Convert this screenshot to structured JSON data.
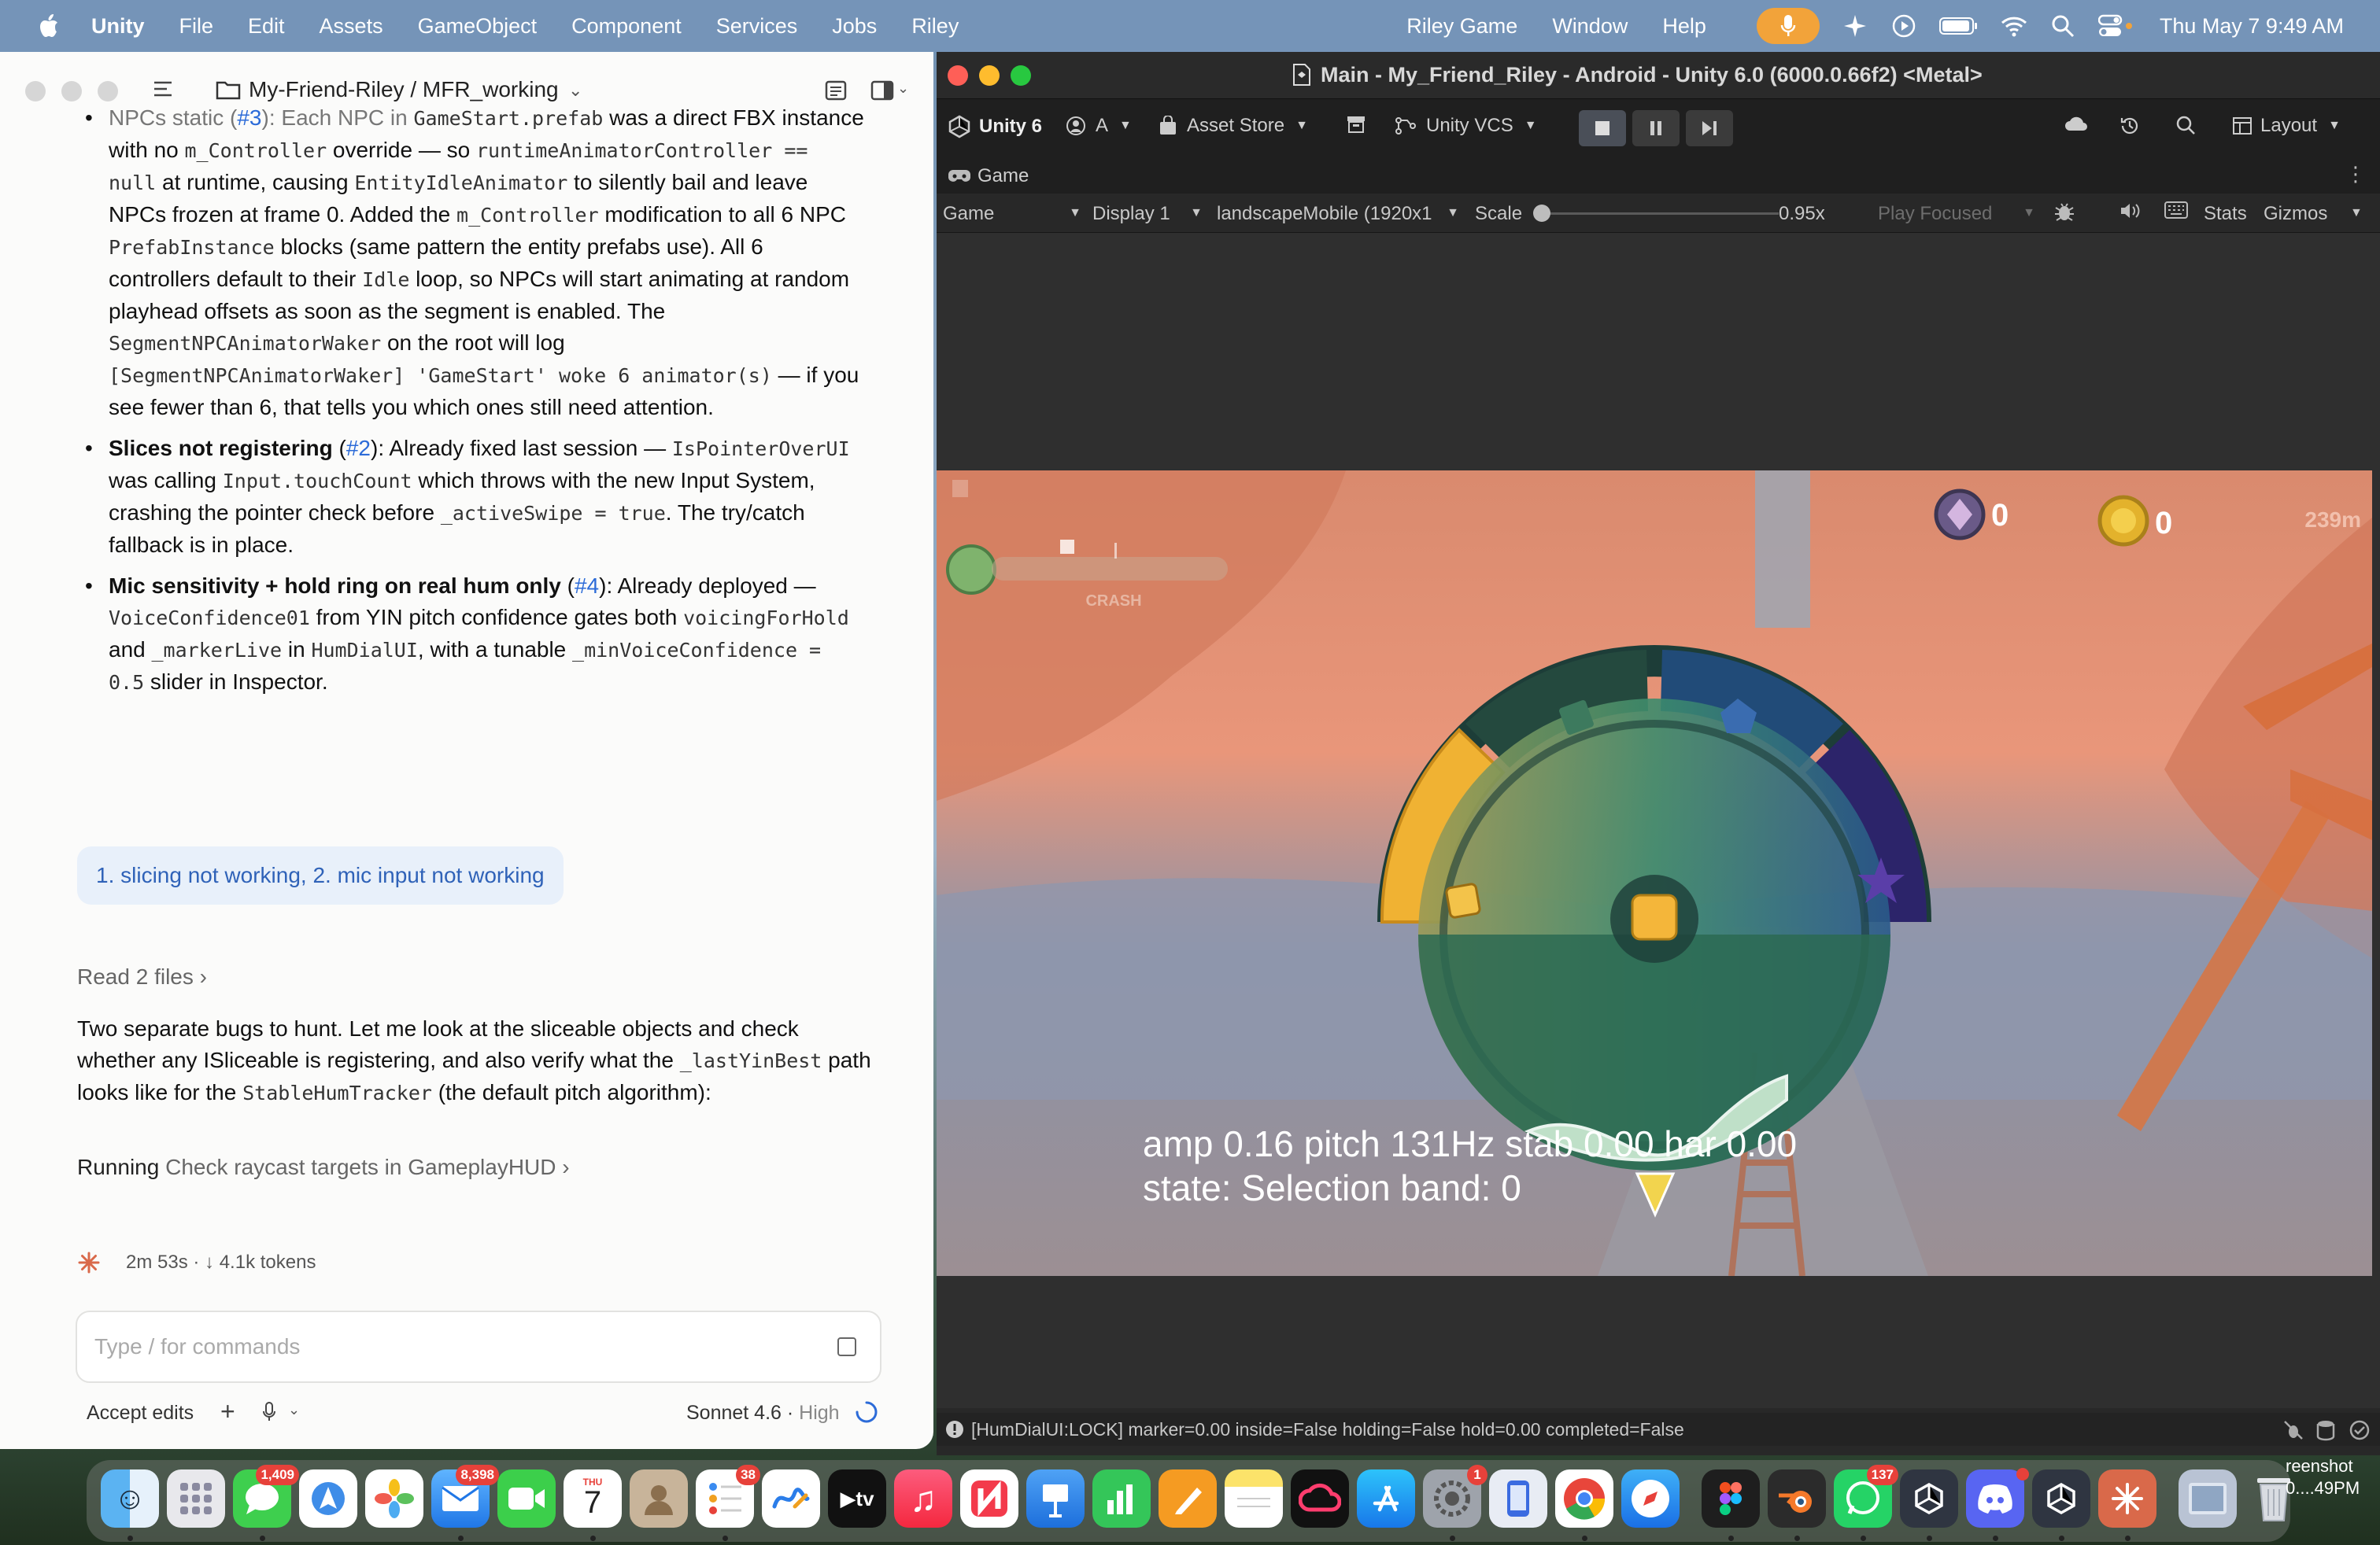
{
  "menubar": {
    "app_name": "Unity",
    "items": [
      "File",
      "Edit",
      "Assets",
      "GameObject",
      "Component",
      "Services",
      "Jobs",
      "Riley"
    ],
    "right_items": [
      "Riley Game",
      "Window",
      "Help"
    ],
    "datetime": "Thu May 7  9:49 AM",
    "icons": [
      "microphone-icon",
      "sparkle-icon",
      "play-circle-icon",
      "battery-icon",
      "wifi-icon",
      "search-icon",
      "control-center-icon"
    ]
  },
  "chat": {
    "breadcrumb": "My-Friend-Riley / MFR_working",
    "bullets": {
      "npc": {
        "title": "NPCs static",
        "ref": "#3",
        "t1": ": Each NPC in ",
        "c1": "GameStart.prefab",
        "t2": " was a direct FBX instance with no ",
        "c2": "m_Controller",
        "t3": " override — so ",
        "c3": "runtimeAnimatorController == null",
        "t4": " at runtime, causing ",
        "c4": "EntityIdleAnimator",
        "t5": " to silently bail and leave NPCs frozen at frame 0. Added the ",
        "c5": "m_Controller",
        "t6": " modification to all 6 NPC ",
        "c6": "PrefabInstance",
        "t7": " blocks (same pattern the entity prefabs use). All 6 controllers default to their ",
        "c7": "Idle",
        "t8": " loop, so NPCs will start animating at random playhead offsets as soon as the segment is enabled. The ",
        "c8": "SegmentNPCAnimatorWaker",
        "t9": " on the root will log ",
        "c9": "[SegmentNPCAnimatorWaker] 'GameStart' woke 6 animator(s)",
        "t10": " — if you see fewer than 6, that tells you which ones still need attention."
      },
      "slices": {
        "title": "Slices not registering",
        "ref": "#2",
        "t1": ": Already fixed last session — ",
        "c1": "IsPointerOverUI",
        "t2": " was calling ",
        "c2": "Input.touchCount",
        "t3": " which throws with the new Input System, crashing the pointer check before ",
        "c3": "_activeSwipe = true",
        "t4": ". The try/catch fallback is in place."
      },
      "mic": {
        "title": "Mic sensitivity + hold ring on real hum only",
        "ref": "#4",
        "t1": ": Already deployed — ",
        "c1": "VoiceConfidence01",
        "t2": " from YIN pitch confidence gates both ",
        "c2": "voicingForHold",
        "t3": " and ",
        "c3": "_markerLive",
        "t4": " in ",
        "c4": "HumDialUI",
        "t5": ", with a tunable ",
        "c5": "_minVoiceConfidence = 0.5",
        "t6": " slider in Inspector."
      }
    },
    "user_message": "1. slicing not working, 2. mic input not working",
    "read_files": "Read 2 files",
    "assistant_para": {
      "t1": "Two separate bugs to hunt. Let me look at the sliceable objects and check whether any ISliceable is registering, and also verify what the ",
      "c1": "_lastYinBest",
      "t2": " path looks like for the ",
      "c2": "StableHumTracker",
      "t3": " (the default pitch algorithm):"
    },
    "running_label": "Running",
    "running_task": "Check raycast targets in GameplayHUD",
    "status": "2m 53s · ↓ 4.1k tokens",
    "input_placeholder": "Type / for commands",
    "accept_label": "Accept edits",
    "model": "Sonnet 4.6",
    "effort": "High"
  },
  "unity": {
    "window_title": "Main - My_Friend_Riley - Android - Unity 6.0 (6000.0.66f2) <Metal>",
    "toolbar": {
      "unity_label": "Unity 6",
      "account": "A",
      "asset_store": "Asset Store",
      "vcs": "Unity VCS",
      "layout": "Layout"
    },
    "tab": "Game",
    "gamebar": {
      "mode": "Game",
      "display": "Display 1",
      "resolution": "landscapeMobile (1920x1",
      "scale_label": "Scale",
      "scale_value": "0.95x",
      "play_focused": "Play Focused",
      "stats": "Stats",
      "gizmos": "Gizmos"
    },
    "scale_level": 0.0,
    "hud": {
      "gem_count": "0",
      "coin_count": "0",
      "distance": "239m",
      "crash_label": "CRASH",
      "line1": "amp 0.16  pitch 131Hz  stab 0.00  har 0.00",
      "line2": "state: Selection  band: 0"
    },
    "console": "[HumDialUI:LOCK] marker=0.00 inside=False holding=False hold=0.00 completed=False"
  },
  "dock": {
    "badges": {
      "messages": "1,409",
      "mail": "8,398",
      "calendar_day": "7",
      "reminders": "38",
      "settings": "1",
      "whatsapp": "137"
    },
    "screenshot_label_1": "reenshot",
    "screenshot_label_2": "0....49PM"
  }
}
